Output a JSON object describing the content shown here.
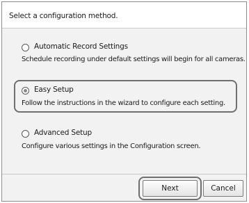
{
  "header": {
    "instruction": "Select a configuration method."
  },
  "options": [
    {
      "label": "Automatic Record Settings",
      "description": "Schedule recording under default settings will begin for all cameras.",
      "selected": false
    },
    {
      "label": "Easy Setup",
      "description": "Follow the instructions in the wizard to configure each setting.",
      "selected": true
    },
    {
      "label": "Advanced Setup",
      "description": "Configure various settings in the Configuration screen.",
      "selected": false
    }
  ],
  "buttons": {
    "next_label": "Next",
    "cancel_label": "Cancel"
  }
}
